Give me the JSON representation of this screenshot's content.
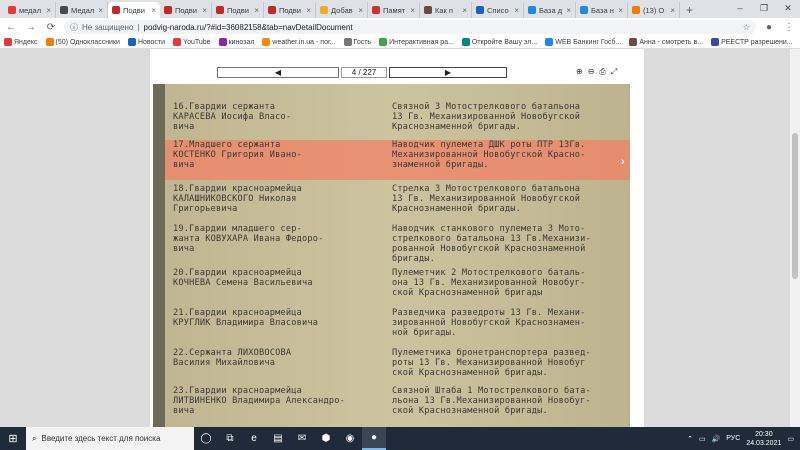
{
  "browser": {
    "tabs": [
      {
        "label": "медал",
        "color": "#e53935",
        "active": false
      },
      {
        "label": "Медал",
        "color": "#4a4a4a",
        "active": false
      },
      {
        "label": "Подви",
        "color": "#c62828",
        "active": true
      },
      {
        "label": "Подви",
        "color": "#c62828",
        "active": false
      },
      {
        "label": "Подви",
        "color": "#c62828",
        "active": false
      },
      {
        "label": "Подви",
        "color": "#c62828",
        "active": false
      },
      {
        "label": "Добав",
        "color": "#f9a825",
        "active": false
      },
      {
        "label": "Памят",
        "color": "#d32f2f",
        "active": false
      },
      {
        "label": "Как п",
        "color": "#6d4c41",
        "active": false
      },
      {
        "label": "Списо",
        "color": "#1565c0",
        "active": false
      },
      {
        "label": "База д",
        "color": "#1e88e5",
        "active": false
      },
      {
        "label": "База н",
        "color": "#1e88e5",
        "active": false
      },
      {
        "label": "(13) О",
        "color": "#f57c00",
        "active": false
      }
    ],
    "new_tab": "+",
    "window_controls": [
      "–",
      "❐",
      "✕"
    ],
    "nav": {
      "back": "←",
      "forward": "→",
      "reload": "⟳"
    },
    "security_label": "Не защищено",
    "url": "podvig-naroda.ru/?#id=36082158&tab=navDetailDocument",
    "bookmarks": [
      {
        "label": "Яндекс",
        "color": "#e53935"
      },
      {
        "label": "(50) Одноклассники",
        "color": "#f57c00"
      },
      {
        "label": "Новости",
        "color": "#1565c0"
      },
      {
        "label": "YouTube",
        "color": "#e53935"
      },
      {
        "label": "кинозал",
        "color": "#8e24aa"
      },
      {
        "label": "weather.in.ua - пог...",
        "color": "#fb8c00"
      },
      {
        "label": "Гость",
        "color": "#757575"
      },
      {
        "label": "Интерактивная ра...",
        "color": "#43a047"
      },
      {
        "label": "Откройте Вашу эл...",
        "color": "#00897b"
      },
      {
        "label": "WEB Банкинг Госб...",
        "color": "#1e88e5"
      },
      {
        "label": "Анна - смотреть в...",
        "color": "#6d4c41"
      },
      {
        "label": "РЕЕСТР разрешени...",
        "color": "#3949ab"
      }
    ]
  },
  "viewer": {
    "prev": "◀",
    "page_indicator": "4 / 227",
    "next": "▶",
    "tools": [
      "⊕",
      "⊖",
      "⎙",
      "⤢"
    ]
  },
  "document": {
    "entries": [
      {
        "left": [
          "16.Гвардии сержанта",
          "КАРАСЕВА Иосифа Власо-",
          "вича"
        ],
        "right": [
          "Связной 3 Мотострелкового батальона",
          "13 Гв. Механизированной Новобугской",
          "Краснознаменной бригады."
        ],
        "highlight": false
      },
      {
        "left": [
          "17.Младшего сержанта",
          "КОСТЕНКО Григория Ивано-",
          "вича"
        ],
        "right": [
          "Наводчик пулемета ДШК роты ПТР 13Гв.",
          "Механизированной Новобугской Красно-",
          "знаменной бригады."
        ],
        "highlight": true
      },
      {
        "left": [
          "18.Гвардии красноармейца",
          "КАЛАШНИКОВСКОГО Николая",
          "Григорьевича"
        ],
        "right": [
          "Стрелка 3 Мотострелкового батальона",
          "13 Гв. Механизированной Новобугской",
          "Краснознаменной бригады."
        ],
        "highlight": false
      },
      {
        "left": [
          "19.Гвардии младшего сер-",
          "жанта КОВУХАРА Ивана Федоро-",
          "вича"
        ],
        "right": [
          "Наводчик станкового пулемета 3 Мото-",
          "стрелкового батальона 13 Гв.Механизи-",
          "рованной Новобугской Краснознаменной",
          "бригады."
        ],
        "highlight": false
      },
      {
        "left": [
          "20.Гвардии красноармейца",
          "КОЧНЕВА Семена Васильевича"
        ],
        "right": [
          "Пулеметчик 2 Мотострелкового баталь-",
          "она 13 Гв. Механизированной Новобуг-",
          "ской Краснознаменной бригады"
        ],
        "highlight": false
      },
      {
        "left": [
          "21.Гвардии красноармейца",
          "КРУГЛИК Владимира Власовича"
        ],
        "right": [
          "Разведчика разведроты 13 Гв. Механи-",
          "зированной Новобугской Краснознамен-",
          "ной бригады."
        ],
        "highlight": false
      },
      {
        "left": [
          "22.Сержанта ЛИХОВОСОВА",
          "Василия Михайловича"
        ],
        "right": [
          "Пулеметчика бронетранспортера развед-",
          "роты 13 Гв. Механизированной Новобуг",
          "ской Краснознаменной бригады."
        ],
        "highlight": false
      },
      {
        "left": [
          "23.Гвардии красноармейца",
          "ЛИТВИНЕНКО Владимира Александро-",
          "вича"
        ],
        "right": [
          "Связной Штаба 1 Мотострелкового бата-",
          "льона 13 Гв.Механизированной Новобуг-",
          "ской Краснознаменной бригады."
        ],
        "highlight": false
      }
    ]
  },
  "taskbar": {
    "start": "⊞",
    "search_placeholder": "Введите здесь текст для поиска",
    "apps": [
      "◯",
      "⧉",
      "e",
      "▤",
      "✉",
      "⬢",
      "◉",
      "●"
    ],
    "tray_icons": [
      "⌃",
      "▭",
      "🔊"
    ],
    "lang": "РУС",
    "time": "20:30",
    "date": "24.03.2021",
    "notify": "▭"
  }
}
